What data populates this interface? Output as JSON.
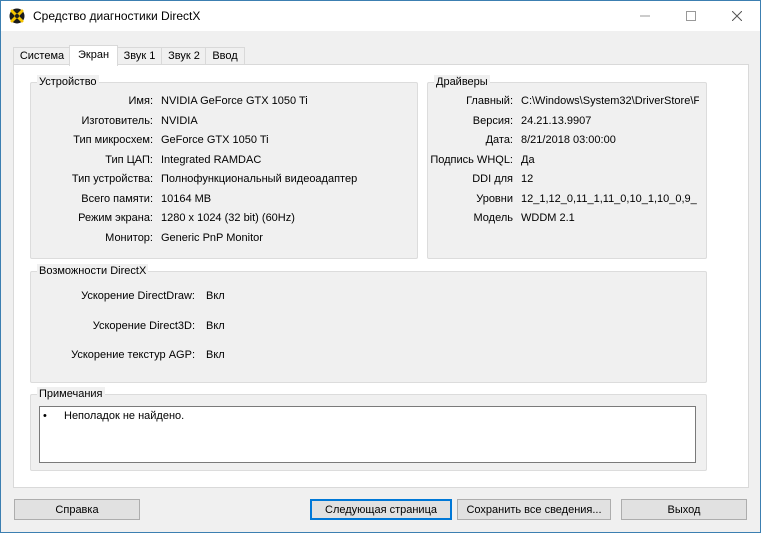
{
  "window": {
    "title": "Средство диагностики DirectX"
  },
  "tabs": [
    {
      "label": "Система"
    },
    {
      "label": "Экран"
    },
    {
      "label": "Звук 1"
    },
    {
      "label": "Звук 2"
    },
    {
      "label": "Ввод"
    }
  ],
  "device": {
    "title": "Устройство",
    "rows": [
      {
        "label": "Имя:",
        "value": "NVIDIA GeForce GTX 1050 Ti"
      },
      {
        "label": "Изготовитель:",
        "value": "NVIDIA"
      },
      {
        "label": "Тип микросхем:",
        "value": "GeForce GTX 1050 Ti"
      },
      {
        "label": "Тип ЦАП:",
        "value": "Integrated RAMDAC"
      },
      {
        "label": "Тип устройства:",
        "value": "Полнофункциональный видеоадаптер"
      },
      {
        "label": "Всего памяти:",
        "value": "10164 MB"
      },
      {
        "label": "Режим экрана:",
        "value": "1280 x 1024 (32 bit) (60Hz)"
      },
      {
        "label": "Монитор:",
        "value": "Generic PnP Monitor"
      }
    ]
  },
  "drivers": {
    "title": "Драйверы",
    "rows": [
      {
        "label": "Главный:",
        "value": "C:\\Windows\\System32\\DriverStore\\F"
      },
      {
        "label": "Версия:",
        "value": "24.21.13.9907"
      },
      {
        "label": "Дата:",
        "value": "8/21/2018 03:00:00"
      },
      {
        "label": "Подпись WHQL:",
        "value": "Да"
      },
      {
        "label": "DDI для",
        "value": "12"
      },
      {
        "label": "Уровни",
        "value": "12_1,12_0,11_1,11_0,10_1,10_0,9_"
      },
      {
        "label": "Модель",
        "value": "WDDM 2.1"
      }
    ]
  },
  "directx": {
    "title": "Возможности DirectX",
    "rows": [
      {
        "label": "Ускорение DirectDraw:",
        "value": "Вкл"
      },
      {
        "label": "Ускорение Direct3D:",
        "value": "Вкл"
      },
      {
        "label": "Ускорение текстур AGP:",
        "value": "Вкл"
      }
    ]
  },
  "notes": {
    "title": "Примечания",
    "bullet": "•",
    "text": "Неполадок не найдено."
  },
  "buttons": {
    "help": "Справка",
    "next": "Следующая страница",
    "save": "Сохранить все сведения...",
    "exit": "Выход"
  },
  "icons": {
    "app": "directx-icon",
    "minimize": "minimize-icon",
    "maximize": "maximize-icon",
    "close": "close-icon"
  }
}
